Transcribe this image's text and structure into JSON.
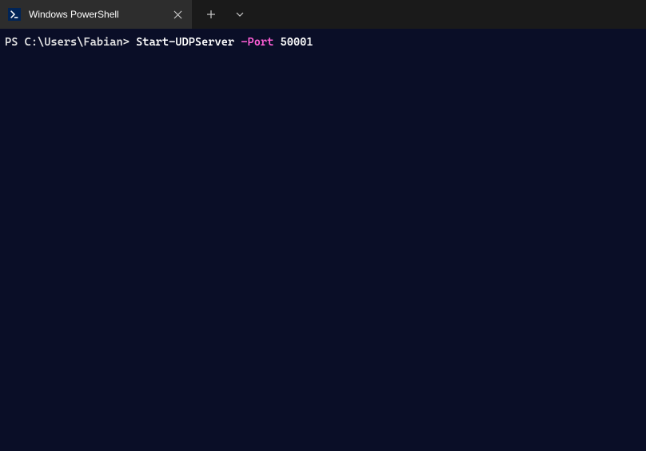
{
  "titlebar": {
    "tab": {
      "title": "Windows PowerShell"
    }
  },
  "terminal": {
    "prompt": "PS C:\\Users\\Fabian> ",
    "command": {
      "cmdlet": "Start-UDPServer",
      "param": "-Port",
      "value": "50001"
    }
  }
}
